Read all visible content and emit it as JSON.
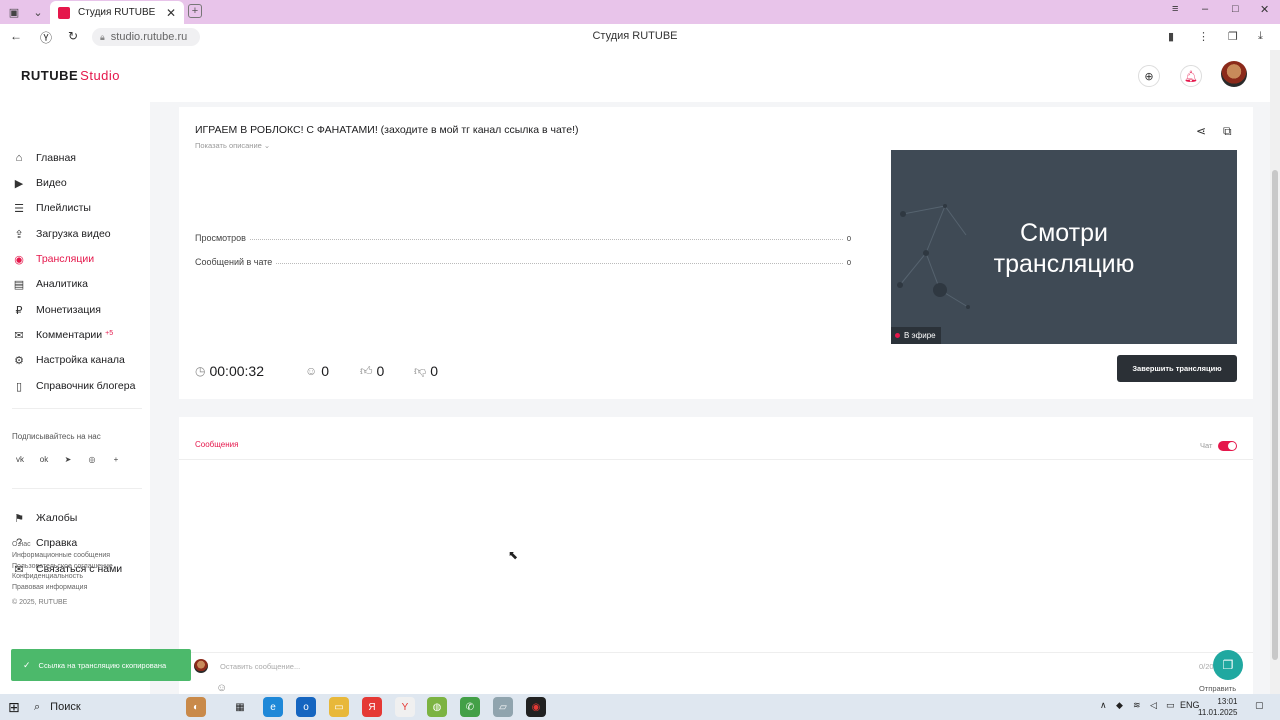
{
  "browser": {
    "tab_title": "Студия RUTUBE",
    "url": "studio.rutube.ru",
    "page_title": "Студия RUTUBE",
    "win_minimize": "–",
    "win_maximize": "□",
    "win_close": "✕"
  },
  "header": {
    "logo_main": "RUTUBE",
    "logo_studio": "Studio"
  },
  "sidebar": {
    "items": [
      {
        "label": "Главная",
        "icon": "home-icon"
      },
      {
        "label": "Видео",
        "icon": "video-icon"
      },
      {
        "label": "Плейлисты",
        "icon": "playlist-icon"
      },
      {
        "label": "Загрузка видео",
        "icon": "upload-icon"
      },
      {
        "label": "Трансляции",
        "icon": "broadcast-icon"
      },
      {
        "label": "Аналитика",
        "icon": "analytics-icon"
      },
      {
        "label": "Монетизация",
        "icon": "monetization-icon"
      },
      {
        "label": "Комментарии",
        "icon": "comments-icon",
        "badge": "+5"
      },
      {
        "label": "Настройка канала",
        "icon": "settings-icon"
      },
      {
        "label": "Справочник блогера",
        "icon": "book-icon"
      }
    ],
    "subscribe_label": "Подписывайтесь на нас",
    "socials": [
      "vk",
      "ok",
      "telegram",
      "viber",
      "+"
    ],
    "support": [
      {
        "label": "Жалобы",
        "icon": "flag-icon"
      },
      {
        "label": "Справка",
        "icon": "help-icon"
      },
      {
        "label": "Связаться с нами",
        "icon": "mail-icon"
      }
    ],
    "footer_links": [
      "О нас",
      "Информационные сообщения",
      "Пользовательское соглашение",
      "Конфиденциальность",
      "Правовая информация"
    ],
    "copyright": "© 2025, RUTUBE"
  },
  "stream": {
    "title": "ИГРАЕМ В РОБЛОКС! С ФАНАТАМИ! (заходите в мой тг канал ссылка в чате!)",
    "show_description": "Показать описание",
    "stats": [
      {
        "label": "Просмотров",
        "value": "0"
      },
      {
        "label": "Сообщений в чате",
        "value": "0"
      }
    ],
    "preview_text_line1": "Смотри",
    "preview_text_line2": "трансляцию",
    "live_badge": "В эфире",
    "duration": "00:00:32",
    "viewers": "0",
    "likes": "0",
    "dislikes": "0",
    "end_button": "Завершить трансляцию"
  },
  "chat": {
    "tab_messages": "Сообщения",
    "chat_toggle_label": "Чат",
    "chat_enabled": true,
    "input_placeholder": "Оставить сообщение...",
    "char_count": "0/200",
    "send_label": "Отправить"
  },
  "toast": {
    "text": "Ссылка на трансляцию скопирована"
  },
  "taskbar": {
    "search_label": "Поиск",
    "lang": "ENG",
    "time": "13:01",
    "date": "11.01.2025"
  },
  "colors": {
    "accent": "#e5174b",
    "toast": "#4cb96b",
    "preview_bg": "#3f4a55",
    "end_button_bg": "#2b3036"
  }
}
